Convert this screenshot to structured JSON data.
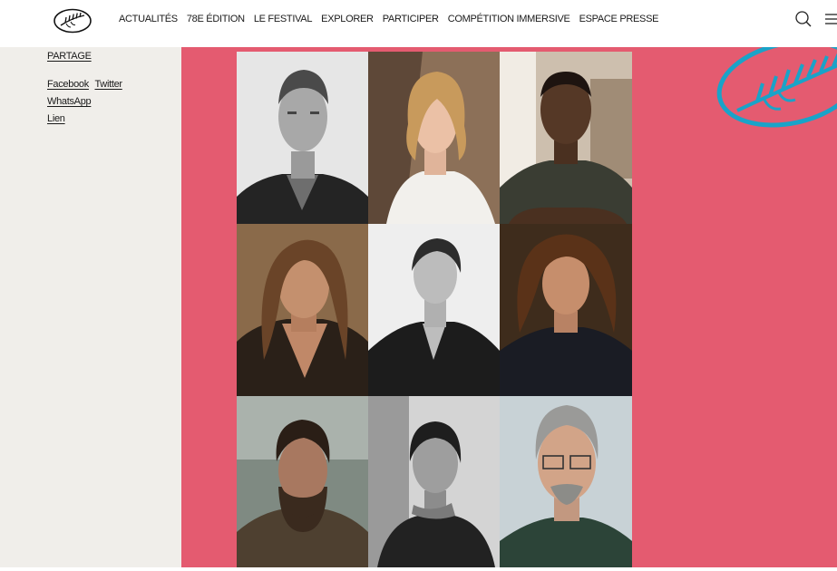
{
  "header": {
    "logo_icon": "cannes-palm-logo-icon",
    "nav": [
      "ACTUALITÉS",
      "78E ÉDITION",
      "LE FESTIVAL",
      "EXPLORER",
      "PARTICIPER",
      "COMPÉTITION IMMERSIVE",
      "ESPACE PRESSE"
    ],
    "search_icon": "search-icon",
    "menu_icon": "hamburger-menu-icon"
  },
  "sidebar": {
    "share_title": "PARTAGE",
    "share_links": [
      "Facebook",
      "Twitter",
      "WhatsApp",
      "Lien"
    ]
  },
  "colors": {
    "accent_pink": "#e45b70",
    "sidebar_bg": "#f0eeea",
    "palm_blue": "#1aa3c8"
  }
}
